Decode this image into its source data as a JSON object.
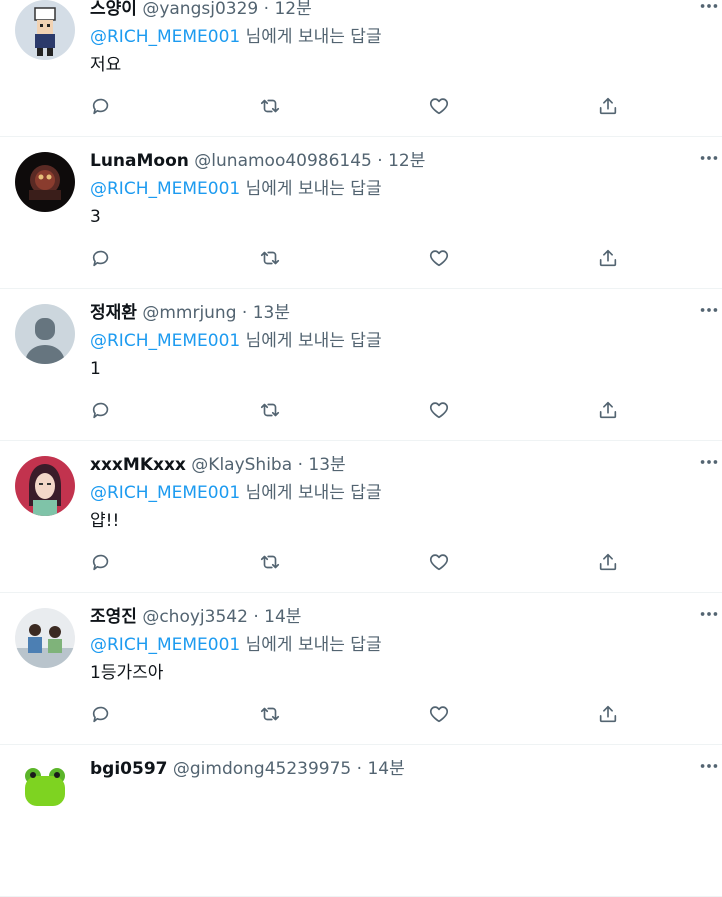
{
  "reply_prefix_suffix": "님에게 보내는 답글",
  "separator": "·",
  "tweets": [
    {
      "name": "스양이",
      "handle": "@yangsj0329",
      "time": "12분",
      "mention": "@RICH_MEME001",
      "text": "저요",
      "avatar": "pixel-character-avatar"
    },
    {
      "name": "LunaMoon",
      "handle": "@lunamoo40986145",
      "time": "12분",
      "mention": "@RICH_MEME001",
      "text": "3",
      "avatar": "dark-creature-avatar"
    },
    {
      "name": "정재환",
      "handle": "@mmrjung",
      "time": "13분",
      "mention": "@RICH_MEME001",
      "text": "1",
      "avatar": "default-avatar"
    },
    {
      "name": "xxxMKxxx",
      "handle": "@KlayShiba",
      "time": "13분",
      "mention": "@RICH_MEME001",
      "text": "얍!!",
      "avatar": "illustrated-girl-avatar"
    },
    {
      "name": "조영진",
      "handle": "@choyj3542",
      "time": "14분",
      "mention": "@RICH_MEME001",
      "text": "1등가즈아",
      "avatar": "kids-photo-avatar"
    },
    {
      "name": "bgi0597",
      "handle": "@gimdong45239975",
      "time": "14분",
      "mention": "",
      "text": "",
      "avatar": "green-frog-avatar"
    }
  ],
  "icons": {
    "reply": "reply-icon",
    "retweet": "retweet-icon",
    "like": "heart-icon",
    "share": "share-icon",
    "more": "more-icon"
  },
  "colors": {
    "link": "#1d9bf0",
    "secondary": "#536471",
    "text": "#0f1419",
    "divider": "#eff3f4"
  }
}
